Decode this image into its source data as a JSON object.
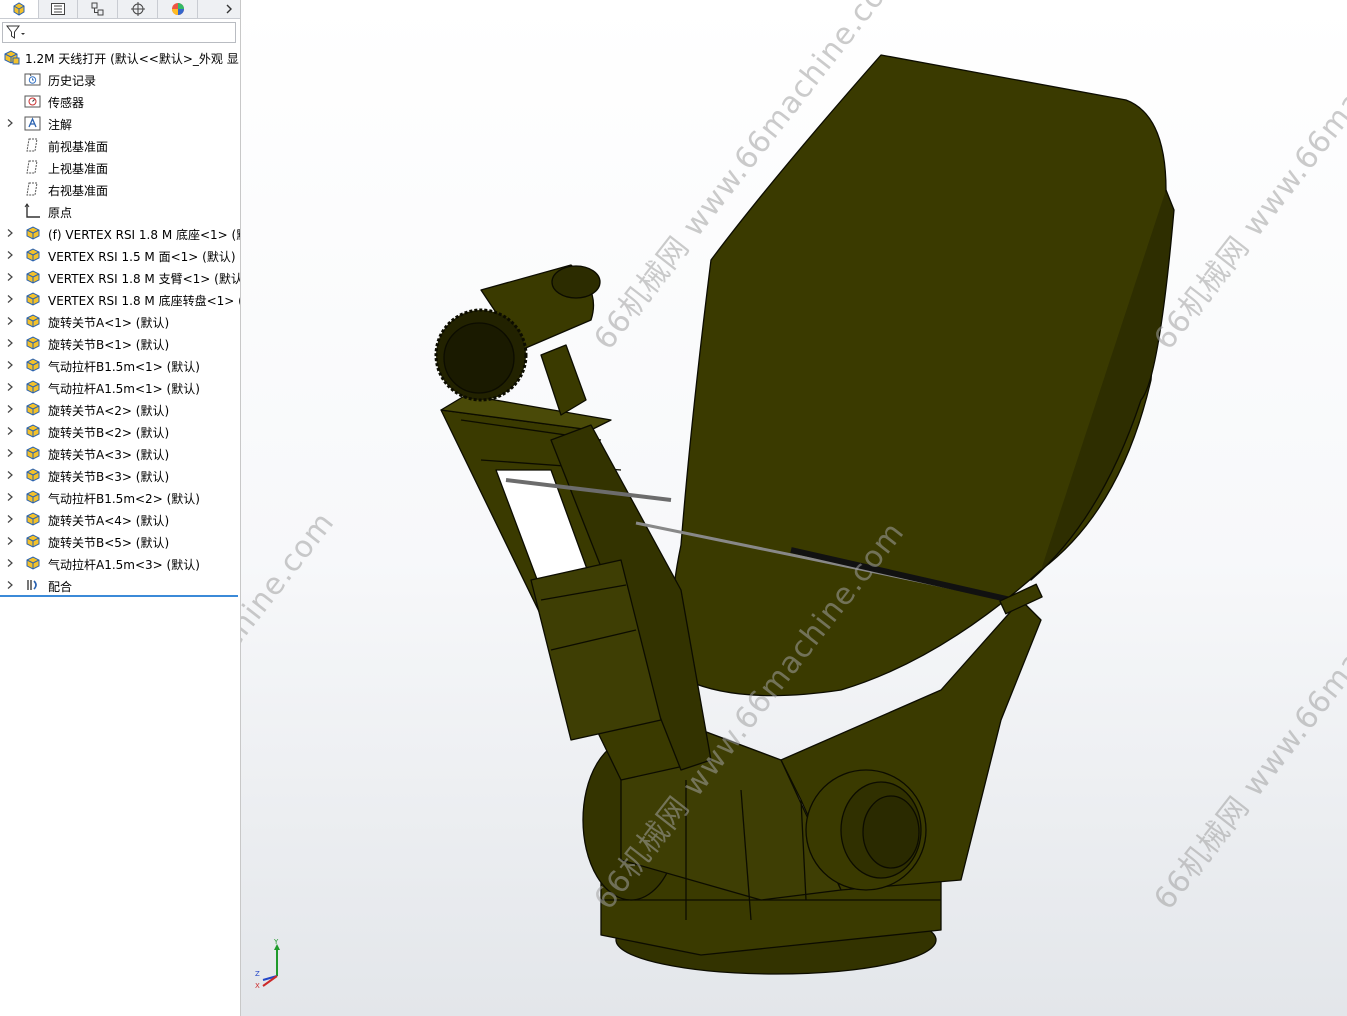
{
  "sidebar": {
    "tabs": [
      {
        "name": "feature-manager-tab",
        "icon": "feature-manager-icon"
      },
      {
        "name": "property-manager-tab",
        "icon": "property-manager-icon"
      },
      {
        "name": "configuration-manager-tab",
        "icon": "configuration-manager-icon"
      },
      {
        "name": "dimxpert-manager-tab",
        "icon": "dimxpert-icon"
      },
      {
        "name": "display-manager-tab",
        "icon": "display-manager-icon"
      }
    ],
    "filter_icon": "filter-icon",
    "root_label": "1.2M 天线打开  (默认<<默认>_外观 显",
    "items": [
      {
        "label": "历史记录",
        "icon": "history-folder-icon",
        "expandable": false
      },
      {
        "label": "传感器",
        "icon": "sensor-icon",
        "expandable": false
      },
      {
        "label": "注解",
        "icon": "annotation-icon",
        "expandable": true
      },
      {
        "label": "前视基准面",
        "icon": "plane-icon",
        "expandable": false
      },
      {
        "label": "上视基准面",
        "icon": "plane-icon",
        "expandable": false
      },
      {
        "label": "右视基准面",
        "icon": "plane-icon",
        "expandable": false
      },
      {
        "label": "原点",
        "icon": "origin-icon",
        "expandable": false
      },
      {
        "label": "(f) VERTEX RSI 1.8 M 底座<1> (默",
        "icon": "part-icon",
        "expandable": true
      },
      {
        "label": "VERTEX RSI 1.5 M 面<1> (默认)",
        "icon": "part-icon",
        "expandable": true
      },
      {
        "label": "VERTEX RSI 1.8 M 支臂<1> (默认",
        "icon": "part-icon",
        "expandable": true
      },
      {
        "label": "VERTEX RSI 1.8 M 底座转盘<1> (",
        "icon": "part-icon",
        "expandable": true
      },
      {
        "label": "旋转关节A<1> (默认)",
        "icon": "part-icon",
        "expandable": true
      },
      {
        "label": "旋转关节B<1> (默认)",
        "icon": "part-icon",
        "expandable": true
      },
      {
        "label": "气动拉杆B1.5m<1> (默认)",
        "icon": "part-icon",
        "expandable": true
      },
      {
        "label": "气动拉杆A1.5m<1> (默认)",
        "icon": "part-icon",
        "expandable": true
      },
      {
        "label": "旋转关节A<2> (默认)",
        "icon": "part-icon",
        "expandable": true
      },
      {
        "label": "旋转关节B<2> (默认)",
        "icon": "part-icon",
        "expandable": true
      },
      {
        "label": "旋转关节A<3> (默认)",
        "icon": "part-icon",
        "expandable": true
      },
      {
        "label": "旋转关节B<3> (默认)",
        "icon": "part-icon",
        "expandable": true
      },
      {
        "label": "气动拉杆B1.5m<2> (默认)",
        "icon": "part-icon",
        "expandable": true
      },
      {
        "label": "旋转关节A<4> (默认)",
        "icon": "part-icon",
        "expandable": true
      },
      {
        "label": "旋转关节B<5> (默认)",
        "icon": "part-icon",
        "expandable": true
      },
      {
        "label": "气动拉杆A1.5m<3> (默认)",
        "icon": "part-icon",
        "expandable": true
      },
      {
        "label": "配合",
        "icon": "mates-icon",
        "expandable": true
      }
    ]
  },
  "viewport": {
    "model_color": "#3a3a00",
    "model_highlight": "#4a4a08",
    "watermark_a": "66机械网 www.66machine.com",
    "triad": {
      "y": "Y",
      "z": "Z",
      "x": "X"
    }
  }
}
